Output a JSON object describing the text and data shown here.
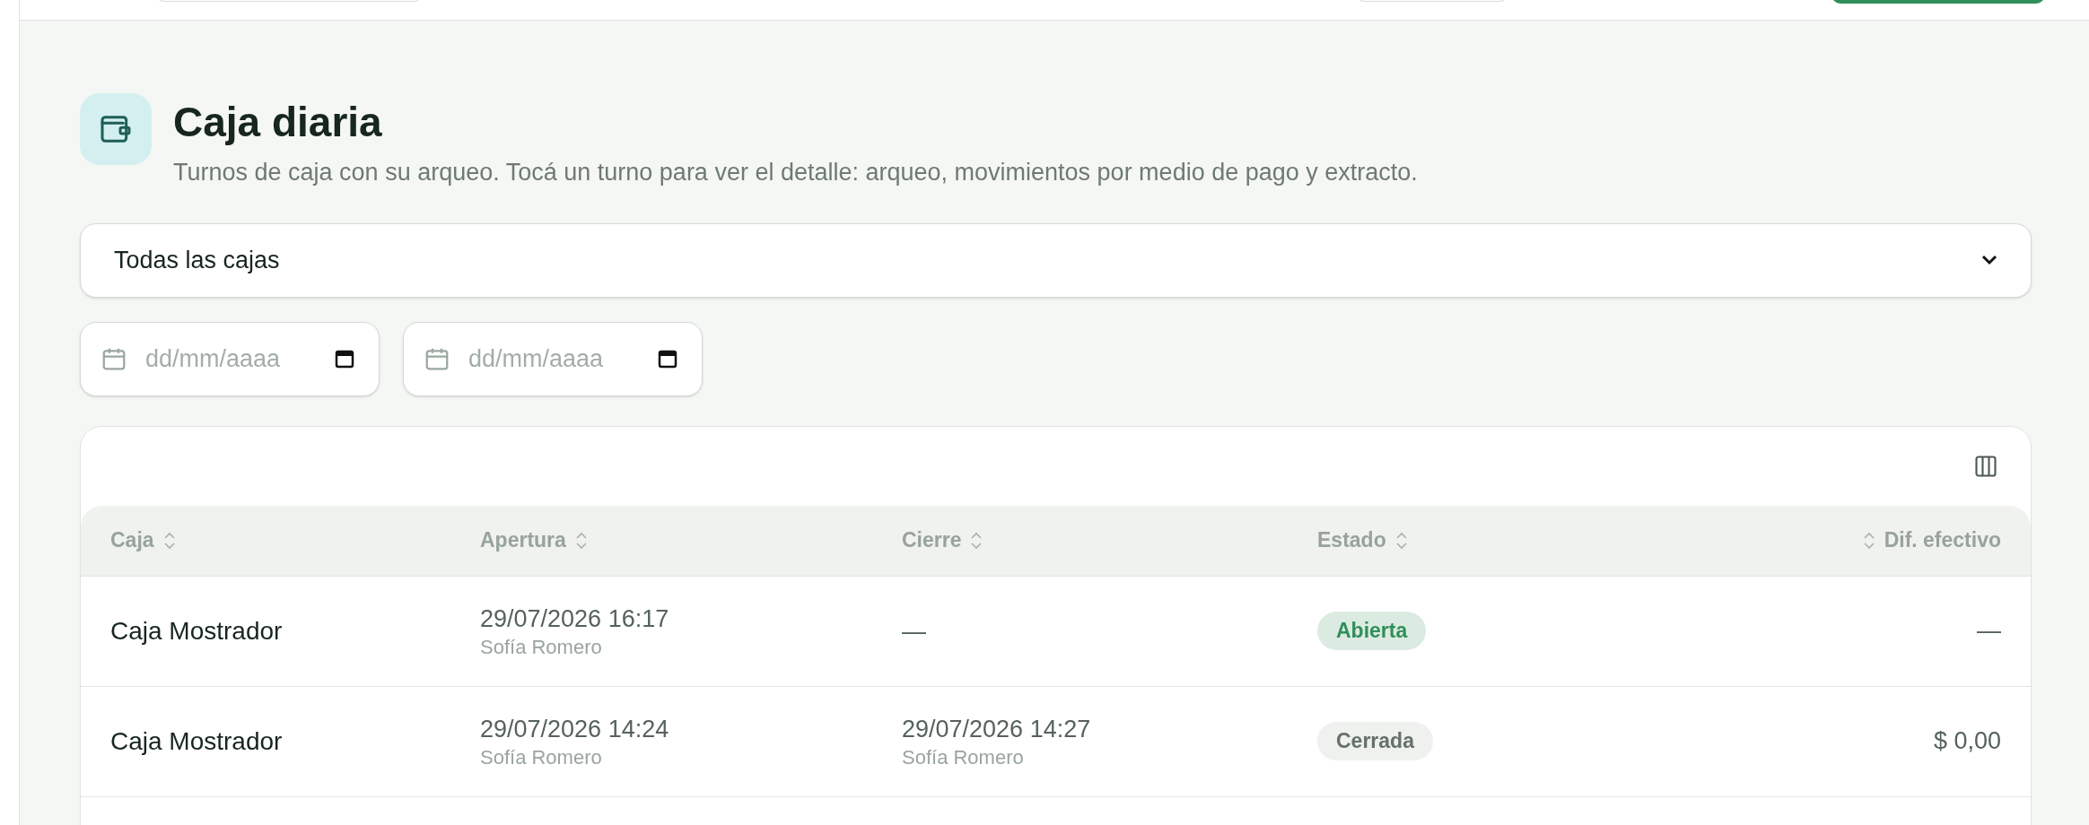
{
  "page": {
    "title": "Caja diaria",
    "subtitle": "Turnos de caja con su arqueo. Tocá un turno para ver el detalle: arqueo, movimientos por medio de pago y extracto."
  },
  "filters": {
    "register_select": "Todas las cajas",
    "date_from": {
      "placeholder": "dd/mm/aaaa"
    },
    "date_to": {
      "placeholder": "dd/mm/aaaa"
    }
  },
  "table": {
    "columns": [
      {
        "label": "Caja"
      },
      {
        "label": "Apertura"
      },
      {
        "label": "Cierre"
      },
      {
        "label": "Estado"
      },
      {
        "label": "Dif. efectivo"
      }
    ],
    "rows": [
      {
        "caja": "Caja Mostrador",
        "apertura": {
          "time": "29/07/2026 16:17",
          "user": "Sofía Romero"
        },
        "cierre": {
          "time": "—"
        },
        "estado": {
          "label": "Abierta",
          "kind": "open"
        },
        "diferencia": "—"
      },
      {
        "caja": "Caja Mostrador",
        "apertura": {
          "time": "29/07/2026 14:24",
          "user": "Sofía Romero"
        },
        "cierre": {
          "time": "29/07/2026 14:27",
          "user": "Sofía Romero"
        },
        "estado": {
          "label": "Cerrada",
          "kind": "closed"
        },
        "diferencia": "$ 0,00"
      },
      {}
    ]
  }
}
